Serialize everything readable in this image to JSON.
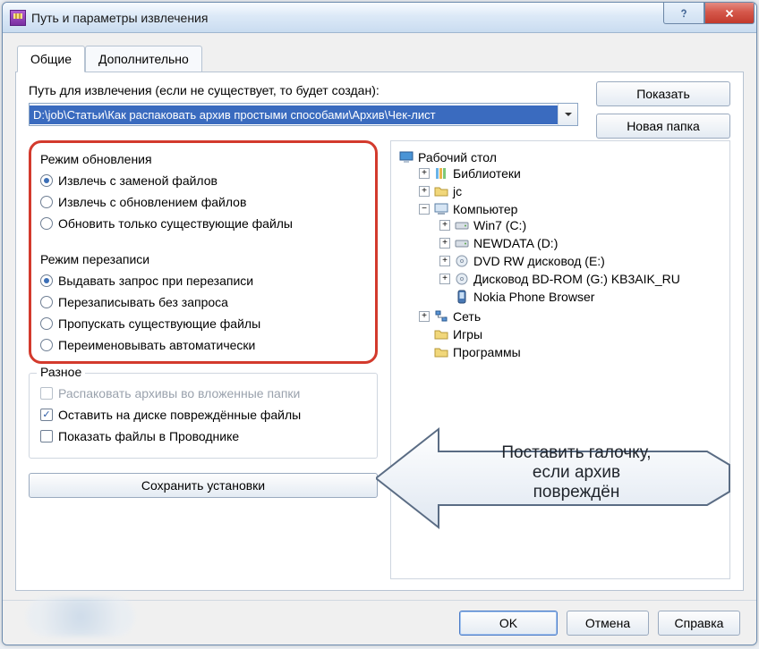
{
  "window": {
    "title": "Путь и параметры извлечения"
  },
  "tabs": {
    "general": "Общие",
    "advanced": "Дополнительно"
  },
  "path": {
    "label": "Путь для извлечения (если не существует, то будет создан):",
    "value": "D:\\job\\Статьи\\Как распаковать архив простыми способами\\Архив\\Чек-лист"
  },
  "buttons": {
    "show": "Показать",
    "newfolder": "Новая папка",
    "save_settings": "Сохранить установки",
    "ok": "OK",
    "cancel": "Отмена",
    "help": "Справка"
  },
  "update_mode": {
    "legend": "Режим обновления",
    "opt1": "Извлечь с заменой файлов",
    "opt2": "Извлечь с обновлением файлов",
    "opt3": "Обновить только существующие файлы"
  },
  "overwrite_mode": {
    "legend": "Режим перезаписи",
    "opt1": "Выдавать запрос при перезаписи",
    "opt2": "Перезаписывать без запроса",
    "opt3": "Пропускать существующие файлы",
    "opt4": "Переименовывать автоматически"
  },
  "misc": {
    "legend": "Разное",
    "opt1": "Распаковать архивы во вложенные папки",
    "opt2": "Оставить на диске повреждённые файлы",
    "opt3": "Показать файлы в Проводнике"
  },
  "tree": {
    "desktop": "Рабочий стол",
    "libraries": "Библиотеки",
    "jc": "jc",
    "computer": "Компьютер",
    "win7": "Win7 (C:)",
    "newdata": "NEWDATA (D:)",
    "dvd": "DVD RW дисковод (E:)",
    "bd": "Дисковод BD-ROM (G:) KB3AIK_RU",
    "nokia": "Nokia Phone Browser",
    "network": "Сеть",
    "games": "Игры",
    "programs": "Программы"
  },
  "callout": {
    "line1": "Поставить галочку,",
    "line2": "если архив",
    "line3": "повреждён"
  }
}
